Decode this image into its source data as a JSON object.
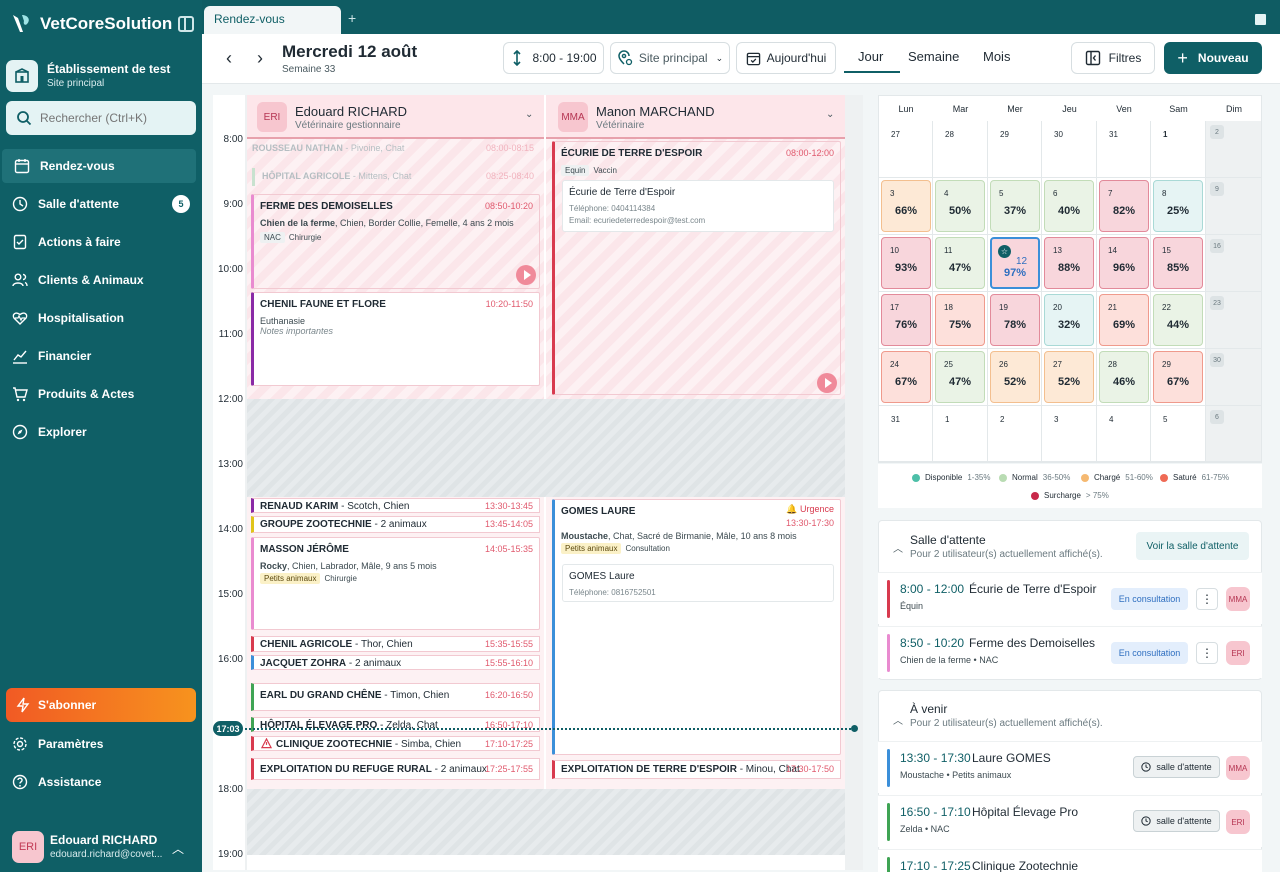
{
  "sidebar": {
    "brand": "VetCoreSolution",
    "establishment": {
      "name": "Établissement de test",
      "site": "Site principal"
    },
    "search_placeholder": "Rechercher (Ctrl+K)",
    "items": [
      {
        "label": "Rendez-vous",
        "icon": "calendar-icon"
      },
      {
        "label": "Salle d'attente",
        "icon": "clock-icon",
        "badge": "5"
      },
      {
        "label": "Actions à faire",
        "icon": "checklist-icon"
      },
      {
        "label": "Clients & Animaux",
        "icon": "users-icon"
      },
      {
        "label": "Hospitalisation",
        "icon": "heartbeat-icon"
      },
      {
        "label": "Financier",
        "icon": "chart-icon"
      },
      {
        "label": "Produits & Actes",
        "icon": "cart-icon"
      },
      {
        "label": "Explorer",
        "icon": "compass-icon"
      }
    ],
    "subscribe": "S'abonner",
    "bottom_items": [
      {
        "label": "Paramètres",
        "icon": "gear-icon"
      },
      {
        "label": "Assistance",
        "icon": "help-icon"
      }
    ],
    "user": {
      "initials": "ERI",
      "name": "Edouard RICHARD",
      "email": "edouard.richard@covet..."
    }
  },
  "tabs": {
    "active": "Rendez-vous"
  },
  "toolbar": {
    "date": "Mercredi 12 août",
    "week": "Semaine 33",
    "hours": "8:00 - 19:00",
    "site": "Site principal",
    "today": "Aujourd'hui",
    "views": [
      "Jour",
      "Semaine",
      "Mois"
    ],
    "active_view": "Jour",
    "filters": "Filtres",
    "new": "Nouveau"
  },
  "calendar": {
    "hours": [
      "8:00",
      "9:00",
      "10:00",
      "11:00",
      "12:00",
      "13:00",
      "14:00",
      "15:00",
      "16:00",
      "17:00",
      "18:00",
      "19:00"
    ],
    "now": "17:03",
    "vets": [
      {
        "initials": "ERI",
        "name": "Edouard RICHARD",
        "role": "Vétérinaire gestionnaire"
      },
      {
        "initials": "MMA",
        "name": "Manon MARCHAND",
        "role": "Vétérinaire"
      }
    ],
    "col1": {
      "faded1": {
        "title": "ROUSSEAU NATHAN",
        "detail": "- Pivoine, Chat",
        "time": "08:00-08:15"
      },
      "faded2": {
        "title": "HÔPITAL AGRICOLE",
        "detail": "- Mittens, Chat",
        "time": "08:25-08:40"
      },
      "a1": {
        "title": "FERME DES DEMOISELLES",
        "time": "08:50-10:20",
        "animal": "Chien de la ferme",
        "detail": ", Chien, Border Collie, Femelle, 4 ans 2 mois",
        "tag1": "NAC",
        "tag2": "Chirurgie"
      },
      "a2": {
        "title": "CHENIL FAUNE ET FLORE",
        "time": "10:20-11:50",
        "sub": "Euthanasie",
        "note": "Notes importantes"
      },
      "r1": {
        "title": "RENAUD KARIM",
        "detail": " - Scotch, Chien",
        "time": "13:30-13:45"
      },
      "r2": {
        "title": "GROUPE ZOOTECHNIE",
        "detail": " - 2 animaux",
        "time": "13:45-14:05"
      },
      "a3": {
        "title": "MASSON JÉRÔME",
        "time": "14:05-15:35",
        "animal": "Rocky",
        "detail": ", Chien, Labrador, Mâle, 9 ans 5 mois",
        "tag1": "Petits animaux",
        "tag2": "Chirurgie"
      },
      "r3": {
        "title": "CHENIL AGRICOLE",
        "detail": " - Thor, Chien",
        "time": "15:35-15:55"
      },
      "r4": {
        "title": "JACQUET ZOHRA",
        "detail": " - 2 animaux",
        "time": "15:55-16:10"
      },
      "r5": {
        "title": "EARL DU GRAND CHÊNE",
        "detail": " - Timon, Chien",
        "time": "16:20-16:50"
      },
      "r6": {
        "title": "HÔPITAL ÉLEVAGE PRO",
        "detail": " - Zelda, Chat",
        "time": "16:50-17:10"
      },
      "r7": {
        "title": "CLINIQUE ZOOTECHNIE",
        "detail": " - Simba, Chien",
        "time": "17:10-17:25"
      },
      "r8": {
        "title": "EXPLOITATION DU REFUGE RURAL",
        "detail": " - 2 animaux",
        "time": "17:25-17:55"
      }
    },
    "col2": {
      "a1": {
        "title": "ÉCURIE DE TERRE D'ESPOIR",
        "time": "08:00-12:00",
        "tag1": "Equin",
        "tag2": "Vaccin",
        "card_name": "Écurie de Terre d'Espoir",
        "phone": "Téléphone: 0404114384",
        "email": "Email: ecuriedeterredespoir@test.com"
      },
      "a2": {
        "title": "GOMES LAURE",
        "urgent": "Urgence",
        "time": "13:30-17:30",
        "animal": "Moustache",
        "detail": ", Chat, Sacré de Birmanie, Mâle, 10 ans 8 mois",
        "tag1": "Petits animaux",
        "tag2": "Consultation",
        "card_name": "GOMES Laure",
        "phone": "Téléphone: 0816752501"
      },
      "r1": {
        "title": "EXPLOITATION DE TERRE D'ESPOIR",
        "detail": " - Minou, Chat",
        "time": "17:30-17:50"
      }
    }
  },
  "month": {
    "days": [
      "Lun",
      "Mar",
      "Mer",
      "Jeu",
      "Ven",
      "Sam",
      "Dim"
    ],
    "rows": [
      [
        {
          "d": "27"
        },
        {
          "d": "28"
        },
        {
          "d": "29"
        },
        {
          "d": "30"
        },
        {
          "d": "31"
        },
        {
          "d": "1"
        },
        {
          "d": "2"
        }
      ],
      [
        {
          "d": "3",
          "p": "66%",
          "s": "charge"
        },
        {
          "d": "4",
          "p": "50%",
          "s": "normal"
        },
        {
          "d": "5",
          "p": "37%",
          "s": "normal"
        },
        {
          "d": "6",
          "p": "40%",
          "s": "normal"
        },
        {
          "d": "7",
          "p": "82%",
          "s": "surcharge"
        },
        {
          "d": "8",
          "p": "25%",
          "s": "dispo"
        },
        {
          "d": "9"
        }
      ],
      [
        {
          "d": "10",
          "p": "93%",
          "s": "surcharge"
        },
        {
          "d": "11",
          "p": "47%",
          "s": "normal"
        },
        {
          "d": "12",
          "p": "97%",
          "s": "today"
        },
        {
          "d": "13",
          "p": "88%",
          "s": "surcharge"
        },
        {
          "d": "14",
          "p": "96%",
          "s": "surcharge"
        },
        {
          "d": "15",
          "p": "85%",
          "s": "surcharge"
        },
        {
          "d": "16"
        }
      ],
      [
        {
          "d": "17",
          "p": "76%",
          "s": "surcharge"
        },
        {
          "d": "18",
          "p": "75%",
          "s": "sature"
        },
        {
          "d": "19",
          "p": "78%",
          "s": "surcharge"
        },
        {
          "d": "20",
          "p": "32%",
          "s": "dispo"
        },
        {
          "d": "21",
          "p": "69%",
          "s": "sature"
        },
        {
          "d": "22",
          "p": "44%",
          "s": "normal"
        },
        {
          "d": "23"
        }
      ],
      [
        {
          "d": "24",
          "p": "67%",
          "s": "sature"
        },
        {
          "d": "25",
          "p": "47%",
          "s": "normal"
        },
        {
          "d": "26",
          "p": "52%",
          "s": "charge"
        },
        {
          "d": "27",
          "p": "52%",
          "s": "charge"
        },
        {
          "d": "28",
          "p": "46%",
          "s": "normal"
        },
        {
          "d": "29",
          "p": "67%",
          "s": "sature"
        },
        {
          "d": "30"
        }
      ],
      [
        {
          "d": "31"
        },
        {
          "d": "1"
        },
        {
          "d": "2"
        },
        {
          "d": "3"
        },
        {
          "d": "4"
        },
        {
          "d": "5"
        },
        {
          "d": "6"
        }
      ]
    ],
    "legend": [
      {
        "label": "Disponible",
        "range": "1-35%",
        "color": "#4dbfa8"
      },
      {
        "label": "Normal",
        "range": "36-50%",
        "color": "#b9dcb3"
      },
      {
        "label": "Chargé",
        "range": "51-60%",
        "color": "#f5b971"
      },
      {
        "label": "Saturé",
        "range": "61-75%",
        "color": "#ef6a55"
      },
      {
        "label": "Surcharge",
        "range": "> 75%",
        "color": "#c8284a"
      }
    ]
  },
  "waiting": {
    "title": "Salle d'attente",
    "subtitle": "Pour 2 utilisateur(s) actuellement affiché(s).",
    "button": "Voir la salle d'attente",
    "rows": [
      {
        "time": "8:00 - 12:00",
        "name": "Écurie de Terre d'Espoir",
        "sub": "Équin",
        "status": "En consultation",
        "initials": "MMA",
        "color": "#d83a4e"
      },
      {
        "time": "8:50 - 10:20",
        "name": "Ferme des Demoiselles",
        "sub": "Chien de la ferme • NAC",
        "status": "En consultation",
        "initials": "ERI",
        "color": "#e98bd0"
      }
    ]
  },
  "upcoming": {
    "title": "À venir",
    "subtitle": "Pour 2 utilisateur(s) actuellement affiché(s).",
    "rows": [
      {
        "time": "13:30 - 17:30",
        "name": "Laure GOMES",
        "sub": "Moustache • Petits animaux",
        "status": "salle d'attente",
        "initials": "MMA",
        "color": "#3b8fd9"
      },
      {
        "time": "16:50 - 17:10",
        "name": "Hôpital Élevage Pro",
        "sub": "Zelda • NAC",
        "status": "salle d'attente",
        "initials": "ERI",
        "color": "#3fa454"
      },
      {
        "time": "17:10 - 17:25",
        "name": "Clinique Zootechnie",
        "sub": "",
        "status": "",
        "initials": "",
        "color": "#3fa454"
      }
    ]
  },
  "colors": {
    "brand": "#0f5f66",
    "accent": "#f15a24"
  }
}
